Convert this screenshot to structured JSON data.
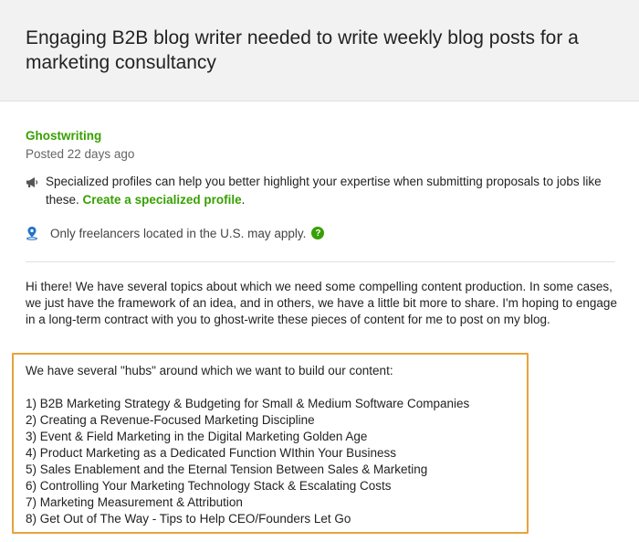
{
  "job": {
    "title": "Engaging B2B blog writer needed to write weekly blog posts for a marketing consultancy",
    "category": "Ghostwriting",
    "posted": "Posted 22 days ago"
  },
  "notice": {
    "text": "Specialized profiles can help you better highlight your expertise when submitting proposals to jobs like these. ",
    "link": "Create a specialized profile",
    "trailing": ".",
    "icon": "megaphone-icon"
  },
  "location": {
    "text": "Only freelancers located in the U.S. may apply.",
    "icon": "location-pin-icon",
    "help_symbol": "?"
  },
  "description": {
    "intro": "Hi there! We have several topics about which we need some compelling content production. In some cases, we just have the framework of an idea, and in others, we have a little bit more to share. I'm hoping to engage in a long-term contract with you to ghost-write these pieces of content for me to post on my blog.",
    "hubs_intro": "We have several \"hubs\" around which we want to build our content:",
    "hubs": [
      "1) B2B Marketing Strategy & Budgeting for Small & Medium Software Companies",
      "2) Creating a Revenue-Focused Marketing Discipline",
      "3) Event & Field Marketing in the Digital Marketing Golden Age",
      "4) Product Marketing as a Dedicated Function WIthin Your Business",
      "5) Sales Enablement and the Eternal Tension Between Sales & Marketing",
      "6) Controlling Your Marketing Technology Stack & Escalating Costs",
      "7) Marketing Measurement & Attribution",
      "8) Get Out of The Way - Tips to Help CEO/Founders Let Go"
    ]
  },
  "colors": {
    "accent_green": "#37a000",
    "highlight_orange": "#e8a33a",
    "header_bg": "#f2f2f2"
  }
}
